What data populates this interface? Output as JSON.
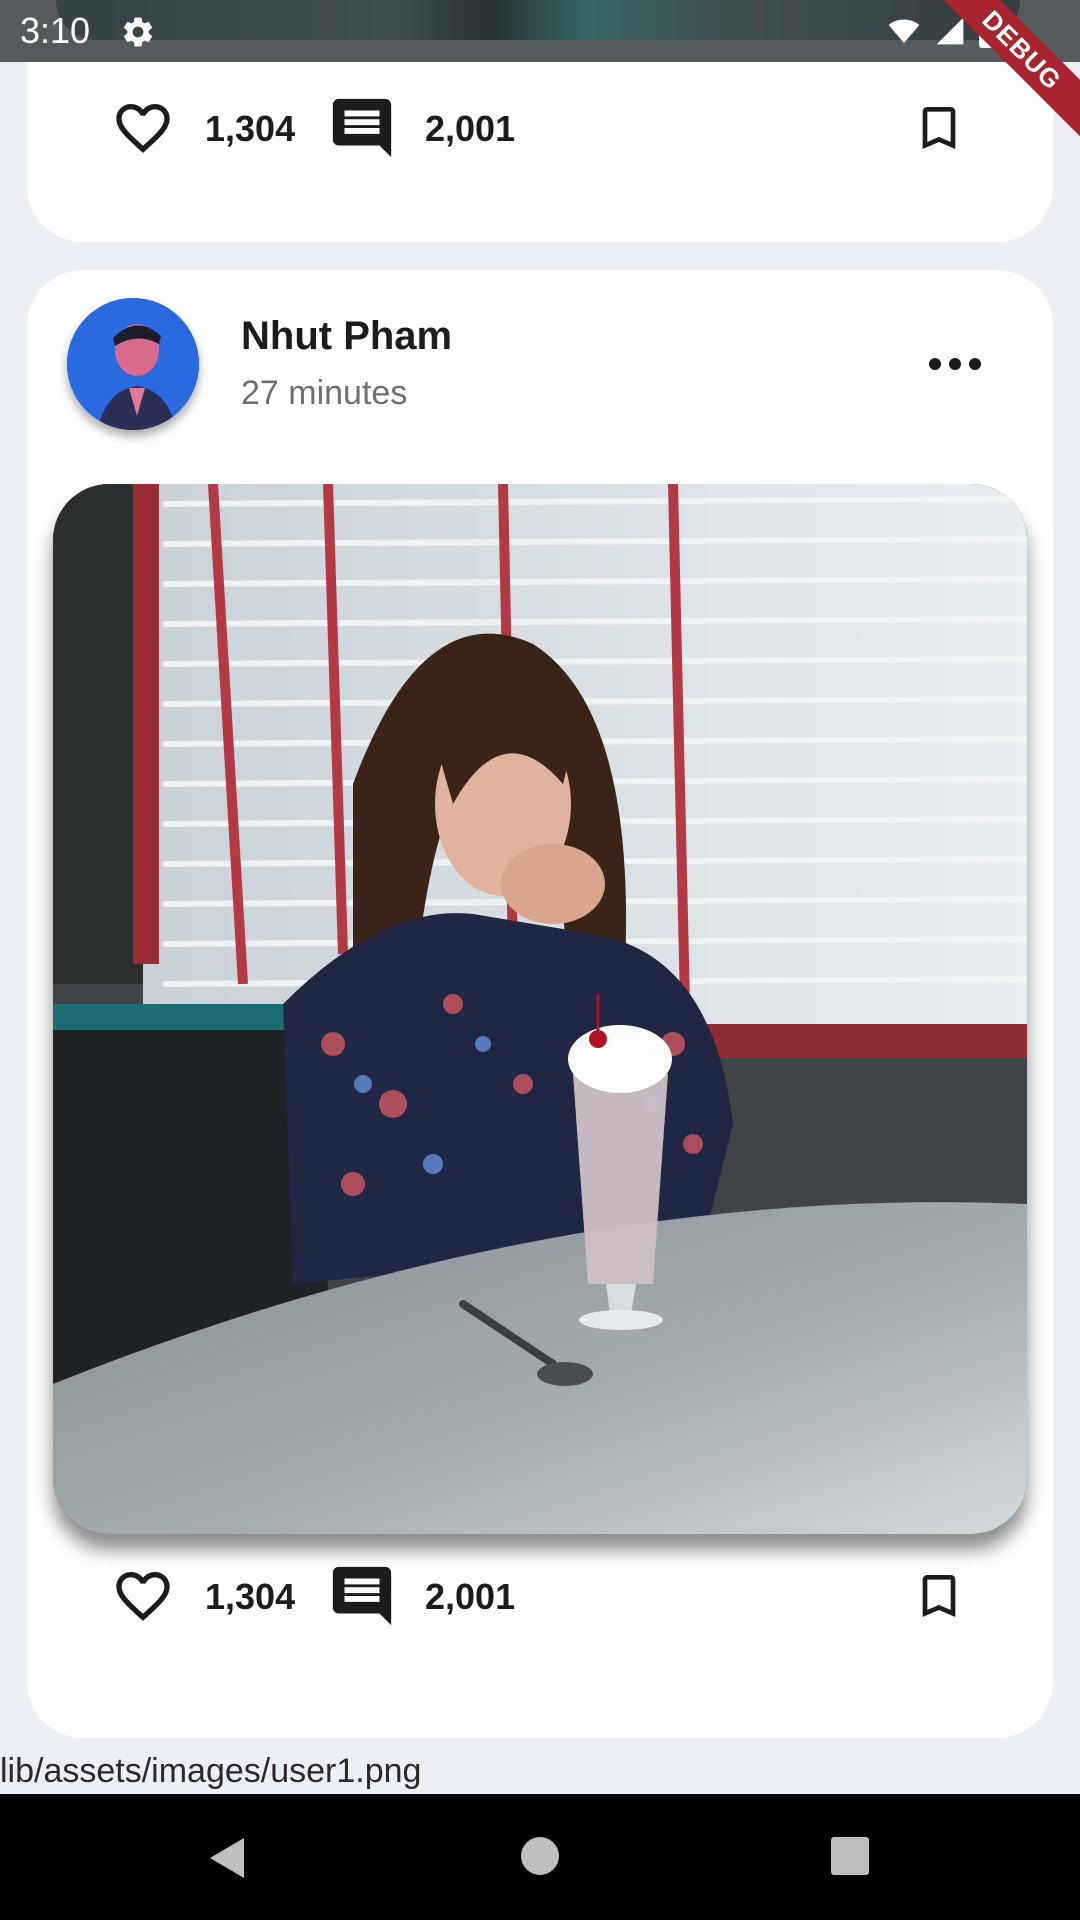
{
  "status_bar": {
    "time": "3:10",
    "debug_label": "DEBUG",
    "icons": [
      "settings-gear-icon",
      "wifi-icon",
      "cell-signal-icon",
      "battery-icon"
    ]
  },
  "previous_post": {
    "likes": "1,304",
    "comments": "2,001"
  },
  "post": {
    "author": "Nhut Pham",
    "time_ago": "27 minutes",
    "likes": "1,304",
    "comments": "2,001",
    "photo_description_icon": "photo-woman-diner-milkshake"
  },
  "footer_caption": "lib/assets/images/user1.png",
  "nav": {
    "icons": [
      "back-triangle-icon",
      "home-circle-icon",
      "recents-square-icon"
    ]
  },
  "colors": {
    "background": "#eceff6",
    "card": "#ffffff",
    "debug_ribbon": "#a8242f",
    "avatar_blue": "#1c5bd2"
  }
}
